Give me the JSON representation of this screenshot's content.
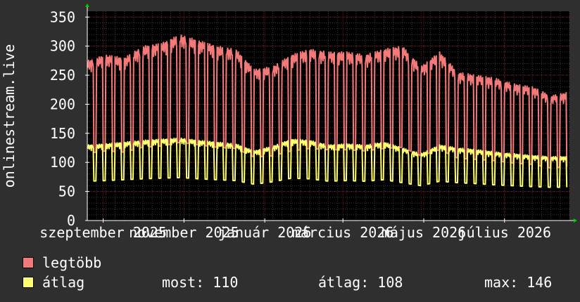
{
  "chart_data": {
    "type": "line",
    "ylabel": "onlinestream.live",
    "ylim": [
      0,
      360
    ],
    "yticks": [
      0,
      50,
      100,
      150,
      200,
      250,
      300,
      350
    ],
    "xlim": [
      "2025-08-20",
      "2026-08-19"
    ],
    "xticks": [
      {
        "label": "szeptember 2025",
        "date": "2025-09-01"
      },
      {
        "label": "november 2025",
        "date": "2025-11-01"
      },
      {
        "label": "január 2026",
        "date": "2026-01-01"
      },
      {
        "label": "március 2026",
        "date": "2026-03-01"
      },
      {
        "label": "május 2026",
        "date": "2026-05-01"
      },
      {
        "label": "július 2026",
        "date": "2026-07-01"
      }
    ],
    "grid": true,
    "colors": {
      "background": "#2f2f2f",
      "plot": "#000000",
      "grid_minor": "#3a3a3a",
      "grid_major": "#6b1a1a",
      "axis": "#ffffff",
      "arrow": "#00cc00"
    },
    "series": [
      {
        "name": "legtöbb",
        "color": "#f47a7a",
        "x": [
          "2025-08-20",
          "2025-09-03",
          "2025-09-17",
          "2025-10-01",
          "2025-10-15",
          "2025-10-29",
          "2025-11-12",
          "2025-11-26",
          "2025-12-10",
          "2025-12-24",
          "2026-01-07",
          "2026-01-21",
          "2026-02-04",
          "2026-02-18",
          "2026-03-04",
          "2026-03-18",
          "2026-04-01",
          "2026-04-15",
          "2026-04-29",
          "2026-05-13",
          "2026-05-27",
          "2026-06-10",
          "2026-06-24",
          "2026-07-08",
          "2026-07-22",
          "2026-08-05",
          "2026-08-17"
        ],
        "y": [
          275,
          285,
          280,
          300,
          305,
          320,
          310,
          300,
          295,
          260,
          265,
          285,
          295,
          290,
          290,
          285,
          295,
          300,
          265,
          290,
          255,
          250,
          245,
          235,
          230,
          215,
          220
        ]
      },
      {
        "name": "átlag",
        "color": "#ffff70",
        "x": [
          "2025-08-20",
          "2025-09-03",
          "2025-09-17",
          "2025-10-01",
          "2025-10-15",
          "2025-10-29",
          "2025-11-12",
          "2025-11-26",
          "2025-12-10",
          "2025-12-24",
          "2026-01-07",
          "2026-01-21",
          "2026-02-04",
          "2026-02-18",
          "2026-03-04",
          "2026-03-18",
          "2026-04-01",
          "2026-04-15",
          "2026-04-29",
          "2026-05-13",
          "2026-05-27",
          "2026-06-10",
          "2026-06-24",
          "2026-07-08",
          "2026-07-22",
          "2026-08-05",
          "2026-08-17"
        ],
        "y": [
          130,
          132,
          135,
          138,
          140,
          142,
          138,
          135,
          132,
          120,
          128,
          140,
          138,
          130,
          132,
          130,
          135,
          125,
          115,
          130,
          125,
          122,
          118,
          115,
          112,
          110,
          110
        ]
      }
    ]
  },
  "legend": {
    "max_label": "legtöbb",
    "avg_label": "átlag",
    "now": "most: 110",
    "average": "átlag: 108",
    "maximum": "max: 146"
  }
}
